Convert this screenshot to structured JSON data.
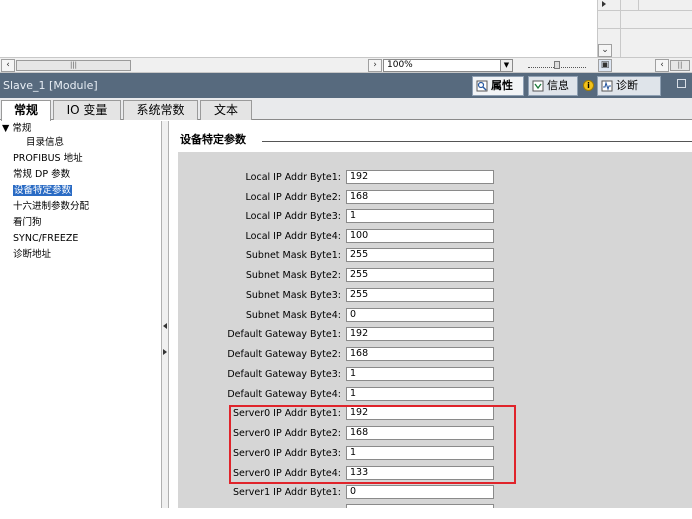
{
  "top_area": {
    "zoom_value": "100%"
  },
  "title_bar": {
    "title": "Slave_1 [Module]",
    "tabs": [
      {
        "label": "属性",
        "icon": "properties-icon",
        "active": true
      },
      {
        "label": "信息",
        "icon": "info-icon",
        "active": false
      },
      {
        "label": "诊断",
        "icon": "diagnostics-icon",
        "active": false
      }
    ]
  },
  "tabs": [
    {
      "label": "常规",
      "active": true
    },
    {
      "label": "IO 变量",
      "active": false
    },
    {
      "label": "系统常数",
      "active": false
    },
    {
      "label": "文本",
      "active": false
    }
  ],
  "nav": {
    "items": [
      {
        "label": "▼ 常规",
        "indent": 0,
        "selected": false
      },
      {
        "label": "目录信息",
        "indent": 1,
        "selected": false
      },
      {
        "label": "PROFIBUS 地址",
        "indent": 0,
        "selected": false
      },
      {
        "label": "常规 DP 参数",
        "indent": 0,
        "selected": false
      },
      {
        "label": "设备特定参数",
        "indent": 0,
        "selected": true
      },
      {
        "label": "十六进制参数分配",
        "indent": 0,
        "selected": false
      },
      {
        "label": "看门狗",
        "indent": 0,
        "selected": false
      },
      {
        "label": "SYNC/FREEZE",
        "indent": 0,
        "selected": false
      },
      {
        "label": "诊断地址",
        "indent": 0,
        "selected": false
      }
    ]
  },
  "section": {
    "title": "设备特定参数"
  },
  "params": [
    {
      "label": "Local IP Addr Byte1:",
      "value": "192"
    },
    {
      "label": "Local IP Addr Byte2:",
      "value": "168"
    },
    {
      "label": "Local IP Addr Byte3:",
      "value": "1"
    },
    {
      "label": "Local IP Addr Byte4:",
      "value": "100"
    },
    {
      "label": "Subnet Mask Byte1:",
      "value": "255"
    },
    {
      "label": "Subnet Mask Byte2:",
      "value": "255"
    },
    {
      "label": "Subnet Mask Byte3:",
      "value": "255"
    },
    {
      "label": "Subnet Mask Byte4:",
      "value": "0"
    },
    {
      "label": "Default Gateway Byte1:",
      "value": "192"
    },
    {
      "label": "Default Gateway Byte2:",
      "value": "168"
    },
    {
      "label": "Default Gateway Byte3:",
      "value": "1"
    },
    {
      "label": "Default Gateway Byte4:",
      "value": "1"
    },
    {
      "label": "Server0 IP Addr Byte1:",
      "value": "192"
    },
    {
      "label": "Server0 IP Addr Byte2:",
      "value": "168"
    },
    {
      "label": "Server0 IP Addr Byte3:",
      "value": "1"
    },
    {
      "label": "Server0 IP Addr Byte4:",
      "value": "133"
    },
    {
      "label": "Server1 IP Addr Byte1:",
      "value": "0"
    }
  ],
  "colors": {
    "title_bar_bg": "#576a7e",
    "selected_nav_bg": "#2a6bc4",
    "highlight_border": "#e0242b",
    "panel_bg": "#d6d6d6"
  }
}
